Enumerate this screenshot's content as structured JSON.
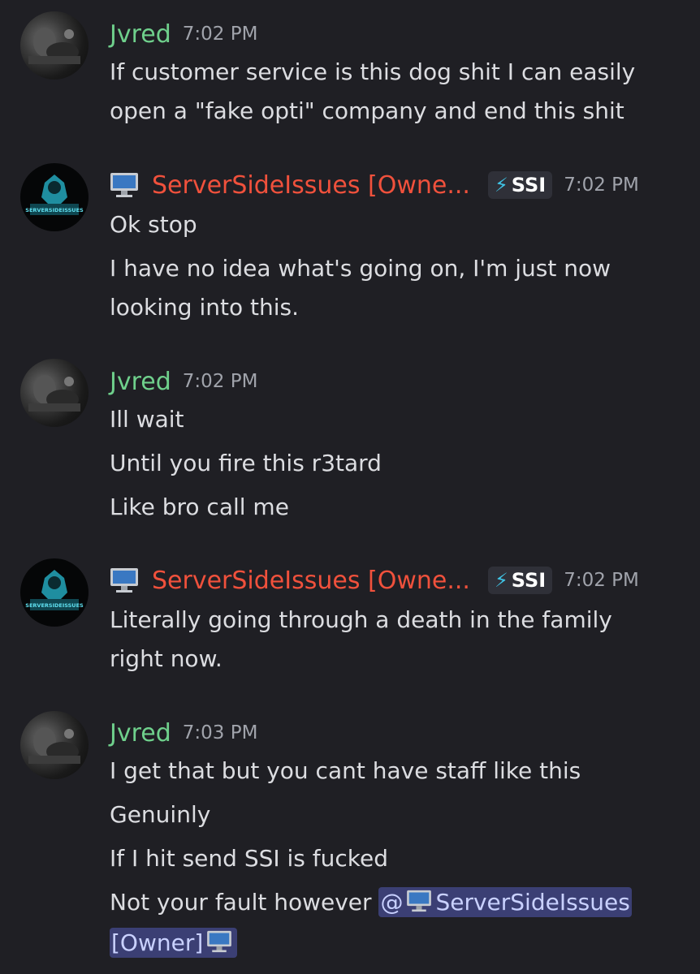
{
  "colors": {
    "background": "#1f1f24",
    "jvred_name": "#6fd08c",
    "owner_name": "#f0513c",
    "mention_bg": "#3b3f74",
    "tag_bolt": "#3fc4e6"
  },
  "messages": [
    {
      "author": "Jvred",
      "time": "7:02 PM",
      "lines": [
        "If customer service is this dog shit I can easily",
        "open a \"fake opti\" company and end this shit"
      ]
    },
    {
      "author": "ServerSideIssues [Owne...",
      "tag": "SSI",
      "time": "7:02 PM",
      "avatar_text": "SERVERSIDEISSUES",
      "lines": [
        "Ok stop",
        "I have no idea what's going on, I'm just now",
        "looking into this."
      ]
    },
    {
      "author": "Jvred",
      "time": "7:02 PM",
      "lines": [
        "Ill wait",
        "Until you fire this r3tard",
        "Like bro call me"
      ]
    },
    {
      "author": "ServerSideIssues [Owne...",
      "tag": "SSI",
      "time": "7:02 PM",
      "avatar_text": "SERVERSIDEISSUES",
      "lines": [
        "Literally going through a death in the family",
        "right now."
      ]
    },
    {
      "author": "Jvred",
      "time": "7:03 PM",
      "lines": [
        "I get that but you cant have staff like this",
        "Genuinly",
        "If I hit send SSI is fucked",
        "Not your fault however "
      ],
      "mention_part1": "ServerSideIssues",
      "mention_at": "@",
      "mention_part2": "[Owner]"
    }
  ]
}
